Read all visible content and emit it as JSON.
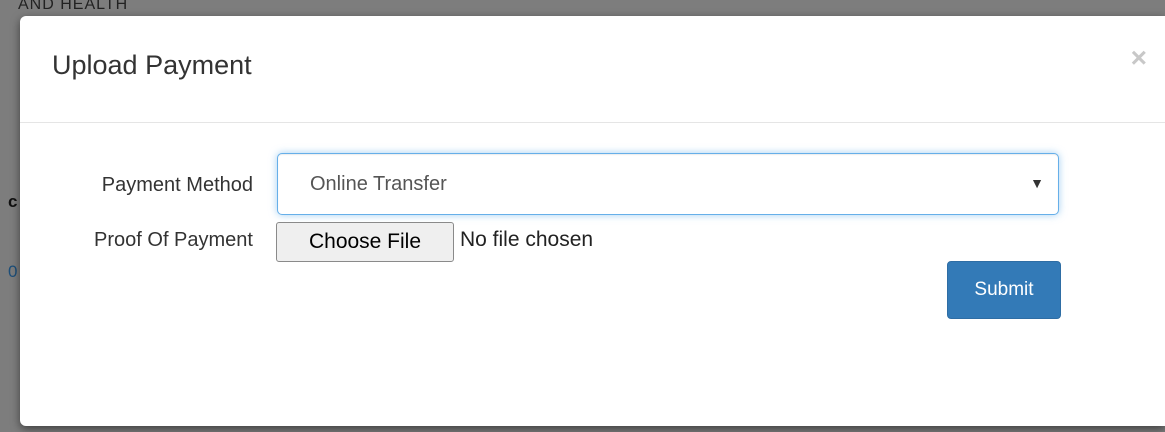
{
  "backdrop": {
    "header_fragment": "AND HEALTH",
    "left_fragment_1": "c",
    "left_fragment_2": "0"
  },
  "modal": {
    "title": "Upload Payment",
    "close_label": "×",
    "payment_method": {
      "label": "Payment Method",
      "selected": "Online Transfer",
      "arrow": "▼"
    },
    "proof_of_payment": {
      "label": "Proof Of Payment",
      "button_label": "Choose File",
      "status": "No file chosen"
    },
    "submit_label": "Submit"
  },
  "colors": {
    "primary_button": "#337ab7",
    "focus_border": "#66afe9",
    "backdrop": "#7d7d7d"
  }
}
